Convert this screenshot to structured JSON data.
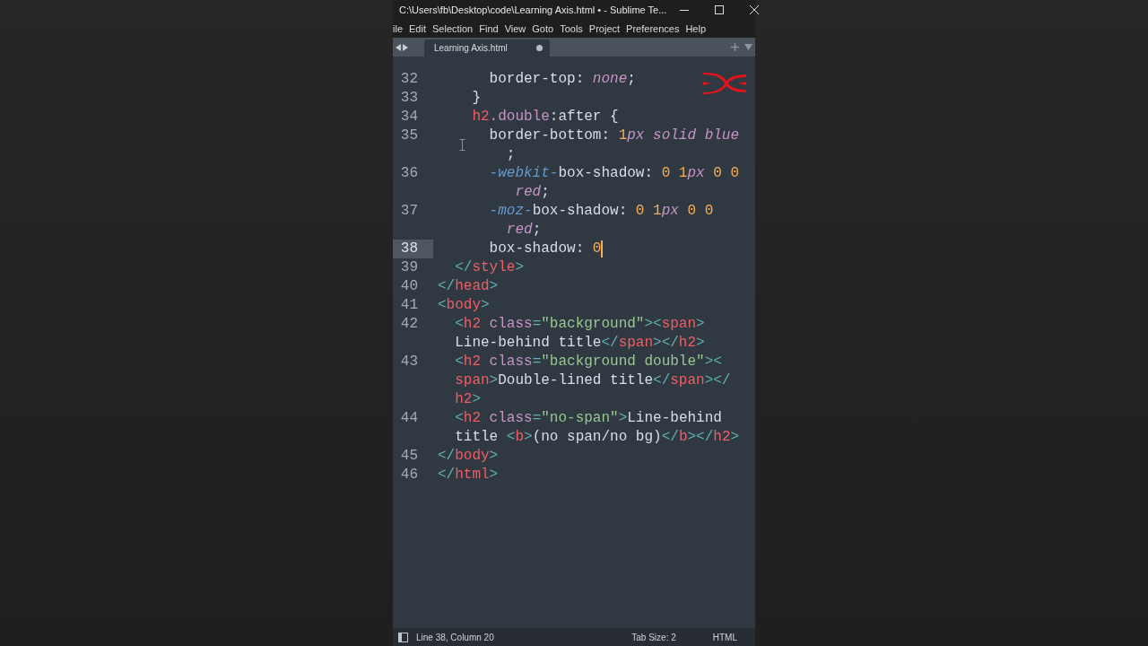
{
  "window": {
    "title": "C:\\Users\\fb\\Desktop\\code\\Learning Axis.html • - Sublime Te..."
  },
  "menu": [
    "ile",
    "Edit",
    "Selection",
    "Find",
    "View",
    "Goto",
    "Tools",
    "Project",
    "Preferences",
    "Help"
  ],
  "tabs": [
    {
      "label": "Learning Axis.html",
      "selected": true,
      "modified": true
    }
  ],
  "code": {
    "lines": [
      {
        "number": "32",
        "current": false,
        "rows": [
          {
            "tokens": [
              {
                "kind": "property",
                "text": "      border-top"
              },
              {
                "kind": "plain",
                "text": ": "
              },
              {
                "kind": "keyword",
                "text": "none"
              },
              {
                "kind": "plain",
                "text": ";"
              }
            ]
          }
        ]
      },
      {
        "number": "33",
        "current": false,
        "rows": [
          {
            "tokens": [
              {
                "kind": "plain",
                "text": "    }"
              }
            ]
          }
        ]
      },
      {
        "number": "34",
        "current": false,
        "rows": [
          {
            "tokens": [
              {
                "kind": "tag",
                "text": "    h2"
              },
              {
                "kind": "class",
                "text": ".double"
              },
              {
                "kind": "plain",
                "text": ":after {"
              }
            ]
          }
        ]
      },
      {
        "number": "35",
        "current": false,
        "rows": [
          {
            "tokens": [
              {
                "kind": "property",
                "text": "      border-bottom"
              },
              {
                "kind": "plain",
                "text": ": "
              },
              {
                "kind": "number",
                "text": "1"
              },
              {
                "kind": "keyword",
                "text": "px solid blue"
              }
            ]
          },
          {
            "tokens": [
              {
                "kind": "plain",
                "text": "        ;"
              }
            ]
          }
        ]
      },
      {
        "number": "36",
        "current": false,
        "rows": [
          {
            "tokens": [
              {
                "kind": "vendor",
                "text": "      -webkit-"
              },
              {
                "kind": "property",
                "text": "box-shadow"
              },
              {
                "kind": "plain",
                "text": ": "
              },
              {
                "kind": "number",
                "text": "0 1"
              },
              {
                "kind": "keyword",
                "text": "px"
              },
              {
                "kind": "number",
                "text": " 0 0"
              }
            ]
          },
          {
            "tokens": [
              {
                "kind": "keyword",
                "text": "         red"
              },
              {
                "kind": "plain",
                "text": ";"
              }
            ]
          }
        ]
      },
      {
        "number": "37",
        "current": false,
        "rows": [
          {
            "tokens": [
              {
                "kind": "vendor",
                "text": "      -moz-"
              },
              {
                "kind": "property",
                "text": "box-shadow"
              },
              {
                "kind": "plain",
                "text": ": "
              },
              {
                "kind": "number",
                "text": "0 1"
              },
              {
                "kind": "keyword",
                "text": "px"
              },
              {
                "kind": "number",
                "text": " 0 0"
              }
            ]
          },
          {
            "tokens": [
              {
                "kind": "keyword",
                "text": "        red"
              },
              {
                "kind": "plain",
                "text": ";"
              }
            ]
          }
        ]
      },
      {
        "number": "38",
        "current": true,
        "rows": [
          {
            "tokens": [
              {
                "kind": "property",
                "text": "      box-shadow"
              },
              {
                "kind": "plain",
                "text": ": "
              },
              {
                "kind": "number",
                "text": "0"
              }
            ]
          }
        ]
      },
      {
        "number": "39",
        "current": false,
        "rows": [
          {
            "tokens": [
              {
                "kind": "punct",
                "text": "  </"
              },
              {
                "kind": "tag",
                "text": "style"
              },
              {
                "kind": "punct",
                "text": ">"
              }
            ]
          }
        ]
      },
      {
        "number": "40",
        "current": false,
        "rows": [
          {
            "tokens": [
              {
                "kind": "punct",
                "text": "</"
              },
              {
                "kind": "tag",
                "text": "head"
              },
              {
                "kind": "punct",
                "text": ">"
              }
            ]
          }
        ]
      },
      {
        "number": "41",
        "current": false,
        "rows": [
          {
            "tokens": [
              {
                "kind": "punct",
                "text": "<"
              },
              {
                "kind": "tag",
                "text": "body"
              },
              {
                "kind": "punct",
                "text": ">"
              }
            ]
          }
        ]
      },
      {
        "number": "42",
        "current": false,
        "rows": [
          {
            "tokens": [
              {
                "kind": "punct",
                "text": "  <"
              },
              {
                "kind": "tag",
                "text": "h2"
              },
              {
                "kind": "attr",
                "text": " class"
              },
              {
                "kind": "punct",
                "text": "="
              },
              {
                "kind": "string",
                "text": "\"background\""
              },
              {
                "kind": "punct",
                "text": "><"
              },
              {
                "kind": "tag",
                "text": "span"
              },
              {
                "kind": "punct",
                "text": ">"
              }
            ]
          },
          {
            "tokens": [
              {
                "kind": "plain",
                "text": "  Line-behind title"
              },
              {
                "kind": "punct",
                "text": "</"
              },
              {
                "kind": "tag",
                "text": "span"
              },
              {
                "kind": "punct",
                "text": "></"
              },
              {
                "kind": "tag",
                "text": "h2"
              },
              {
                "kind": "punct",
                "text": ">"
              }
            ]
          }
        ]
      },
      {
        "number": "43",
        "current": false,
        "rows": [
          {
            "tokens": [
              {
                "kind": "punct",
                "text": "  <"
              },
              {
                "kind": "tag",
                "text": "h2"
              },
              {
                "kind": "attr",
                "text": " class"
              },
              {
                "kind": "punct",
                "text": "="
              },
              {
                "kind": "string",
                "text": "\"background double\""
              },
              {
                "kind": "punct",
                "text": "><"
              }
            ]
          },
          {
            "tokens": [
              {
                "kind": "tag",
                "text": "  span"
              },
              {
                "kind": "punct",
                "text": ">"
              },
              {
                "kind": "plain",
                "text": "Double-lined title"
              },
              {
                "kind": "punct",
                "text": "</"
              },
              {
                "kind": "tag",
                "text": "span"
              },
              {
                "kind": "punct",
                "text": "></"
              }
            ]
          },
          {
            "tokens": [
              {
                "kind": "tag",
                "text": "  h2"
              },
              {
                "kind": "punct",
                "text": ">"
              }
            ]
          }
        ]
      },
      {
        "number": "44",
        "current": false,
        "rows": [
          {
            "tokens": [
              {
                "kind": "punct",
                "text": "  <"
              },
              {
                "kind": "tag",
                "text": "h2"
              },
              {
                "kind": "attr",
                "text": " class"
              },
              {
                "kind": "punct",
                "text": "="
              },
              {
                "kind": "string",
                "text": "\"no-span\""
              },
              {
                "kind": "punct",
                "text": ">"
              },
              {
                "kind": "plain",
                "text": "Line-behind"
              }
            ]
          },
          {
            "tokens": [
              {
                "kind": "plain",
                "text": "  title "
              },
              {
                "kind": "punct",
                "text": "<"
              },
              {
                "kind": "tag",
                "text": "b"
              },
              {
                "kind": "punct",
                "text": ">"
              },
              {
                "kind": "plain",
                "text": "(no span/no bg)"
              },
              {
                "kind": "punct",
                "text": "</"
              },
              {
                "kind": "tag",
                "text": "b"
              },
              {
                "kind": "punct",
                "text": "></"
              },
              {
                "kind": "tag",
                "text": "h2"
              },
              {
                "kind": "punct",
                "text": ">"
              }
            ]
          }
        ]
      },
      {
        "number": "45",
        "current": false,
        "rows": [
          {
            "tokens": [
              {
                "kind": "punct",
                "text": "</"
              },
              {
                "kind": "tag",
                "text": "body"
              },
              {
                "kind": "punct",
                "text": ">"
              }
            ]
          }
        ]
      },
      {
        "number": "46",
        "current": false,
        "rows": [
          {
            "tokens": [
              {
                "kind": "punct",
                "text": "</"
              },
              {
                "kind": "tag",
                "text": "html"
              },
              {
                "kind": "punct",
                "text": ">"
              }
            ]
          }
        ]
      }
    ]
  },
  "status_bar": {
    "position": "Line 38, Column 20",
    "tab_size": "Tab Size: 2",
    "syntax": "HTML"
  }
}
